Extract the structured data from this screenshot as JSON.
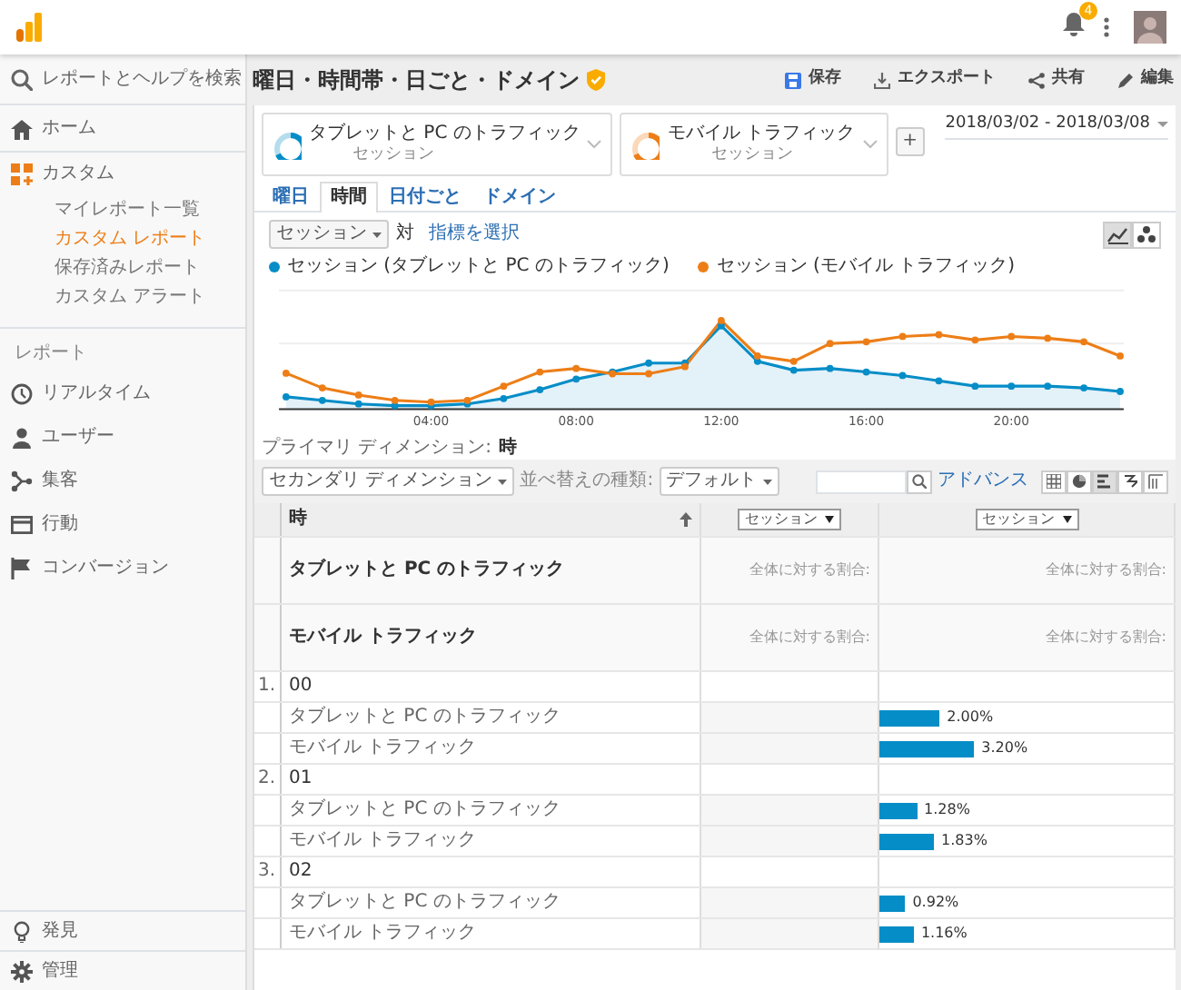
{
  "header": {
    "notification_count": "4"
  },
  "sidebar": {
    "search": "レポートとヘルプを検索",
    "home": "ホーム",
    "custom": {
      "label": "カスタム",
      "children": [
        {
          "label": "マイレポート一覧",
          "selected": false
        },
        {
          "label": "カスタム レポート",
          "selected": true
        },
        {
          "label": "保存済みレポート",
          "selected": false
        },
        {
          "label": "カスタム アラート",
          "selected": false
        }
      ]
    },
    "section_label": "レポート",
    "reports": [
      "リアルタイム",
      "ユーザー",
      "集客",
      "行動",
      "コンバージョン"
    ],
    "footer": [
      "発見",
      "管理"
    ]
  },
  "report": {
    "title": "曜日・時間帯・日ごと・ドメイン",
    "actions": [
      "保存",
      "エクスポート",
      "共有",
      "編集"
    ],
    "segments": [
      {
        "title": "タブレットと PC のトラフィック",
        "subtitle": "セッション",
        "color": "#058dc7"
      },
      {
        "title": "モバイル トラフィック",
        "subtitle": "セッション",
        "color": "#ed7e17"
      }
    ],
    "add_segment": "+",
    "date_range": "2018/03/02 - 2018/03/08",
    "tabs": [
      {
        "label": "曜日",
        "selected": false
      },
      {
        "label": "時間",
        "selected": true
      },
      {
        "label": "日付ごと",
        "selected": false
      },
      {
        "label": "ドメイン",
        "selected": false
      }
    ],
    "metric_select": "セッション",
    "versus": "対",
    "choose_metric": "指標を選択",
    "chart_views": [
      {
        "selected": true
      },
      {
        "selected": false
      }
    ],
    "chart": {
      "legend": [
        {
          "label": "セッション (タブレットと PC のトラフィック)",
          "color": "#058dc7"
        },
        {
          "label": "セッション (モバイル トラフィック)",
          "color": "#ed7e17"
        }
      ],
      "x_labels": [
        "04:00",
        "08:00",
        "12:00",
        "16:00",
        "20:00"
      ]
    },
    "primary_dimension": {
      "label": "プライマリ ディメンション:",
      "value": "時"
    },
    "toolbar": {
      "secondary": "セカンダリ ディメンション",
      "sort_label": "並べ替えの種類:",
      "sort_value": "デフォルト",
      "advanced": "アドバンス",
      "views": [
        {
          "selected": false
        },
        {
          "selected": false
        },
        {
          "selected": true
        },
        {
          "selected": false
        },
        {
          "selected": false
        }
      ]
    },
    "table": {
      "column_1": "時",
      "metric_selects": [
        "セッション",
        "セッション"
      ],
      "summary": [
        {
          "label": "タブレットと PC のトラフィック",
          "share_1": "全体に対する割合:",
          "share_2": "全体に対する割合:"
        },
        {
          "label": "モバイル トラフィック",
          "share_1": "全体に対する割合:",
          "share_2": "全体に対する割合:"
        }
      ],
      "groups": [
        {
          "index": "1.",
          "value": "00",
          "rows": [
            {
              "label": "タブレットと PC のトラフィック",
              "share": "2.00%",
              "level": 0.21
            },
            {
              "label": "モバイル トラフィック",
              "share": "3.20%",
              "level": 0.33
            }
          ]
        },
        {
          "index": "2.",
          "value": "01",
          "rows": [
            {
              "label": "タブレットと PC のトラフィック",
              "share": "1.28%",
              "level": 0.13
            },
            {
              "label": "モバイル トラフィック",
              "share": "1.83%",
              "level": 0.19
            }
          ]
        },
        {
          "index": "3.",
          "value": "02",
          "rows": [
            {
              "label": "タブレットと PC のトラフィック",
              "share": "0.92%",
              "level": 0.09
            },
            {
              "label": "モバイル トラフィック",
              "share": "1.16%",
              "level": 0.12
            }
          ]
        }
      ]
    }
  }
}
